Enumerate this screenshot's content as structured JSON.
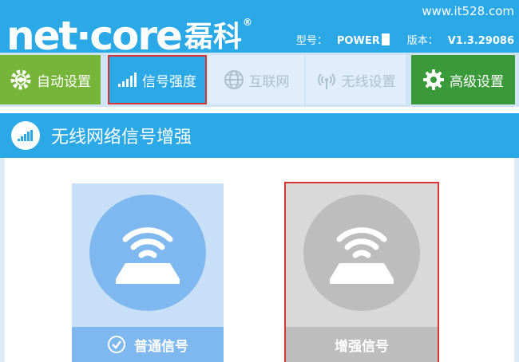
{
  "header": {
    "logo": "net·core",
    "logo_cn": "磊科",
    "logo_mark": "®",
    "site": "www.it528.com",
    "model_label": "型号：",
    "model_value": "POWER",
    "version_label": "版本：",
    "version_value": "V1.3.29086"
  },
  "nav": {
    "items": [
      {
        "label": "自动设置",
        "icon": "gear-icon"
      },
      {
        "label": "信号强度",
        "icon": "signal-bars-icon"
      },
      {
        "label": "互联网",
        "icon": "globe-icon"
      },
      {
        "label": "无线设置",
        "icon": "wireless-tower-icon"
      },
      {
        "label": "高级设置",
        "icon": "gear-icon"
      }
    ]
  },
  "panel": {
    "title": "无线网络信号增强",
    "title_icon": "signal-bars-icon"
  },
  "modes": [
    {
      "label": "普通信号",
      "selected": true,
      "icon": "router-wifi-icon"
    },
    {
      "label": "增强信号",
      "selected": false,
      "icon": "router-wifi-icon"
    }
  ],
  "colors": {
    "header_blue": "#2aa9e6",
    "auto_green": "#76b53a",
    "advanced_green": "#3a9a3a",
    "highlight_red": "#d93535",
    "normal_blue": "#7fb8ee",
    "enhanced_gray": "#bdbdbd"
  }
}
